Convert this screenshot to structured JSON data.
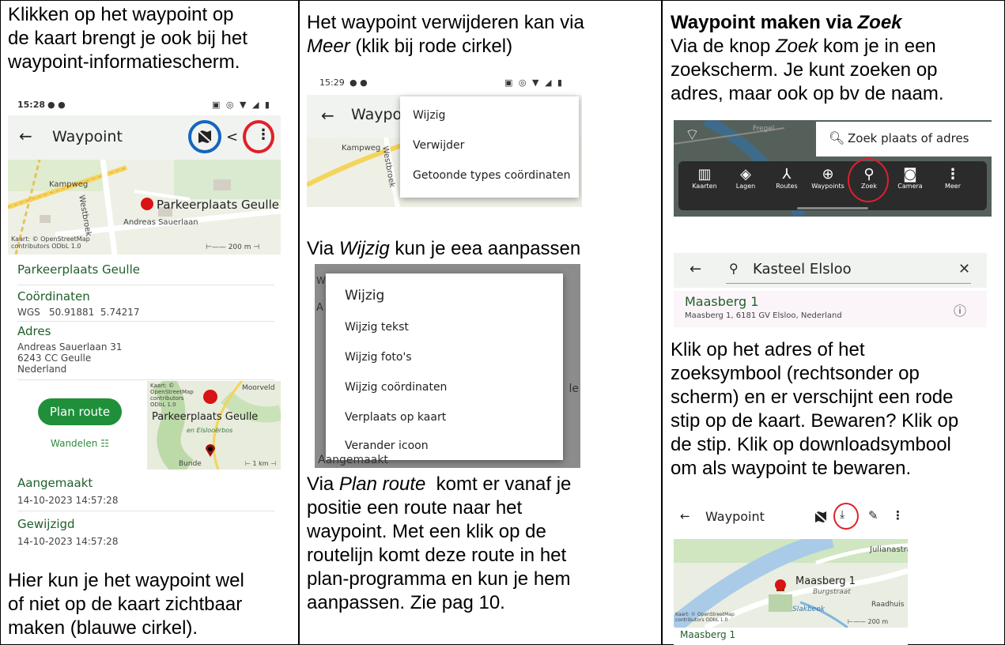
{
  "col1": {
    "intro": [
      "Klikken op het waypoint op",
      "de kaart brengt je ook bij het",
      "waypoint-informatiescherm."
    ],
    "outro": [
      "Hier kun je het waypoint wel",
      "of niet op de kaart zichtbaar",
      "maken (blauwe cirkel)."
    ],
    "screen": {
      "status_time": "15:28",
      "title": "Waypoint",
      "map_label_1": "Kampweg",
      "map_label_2": "Westbroek",
      "map_label_3": "Andreas Sauerlaan",
      "marker_label": "Parkeerplaats Geulle",
      "attribution": "Kaart: © OpenStreetMap contributors ODbL 1.0",
      "scale": "200 m",
      "name": "Parkeerplaats Geulle",
      "coords_heading": "Coördinaten",
      "coords_system": "WGS",
      "coords_value": "50.91881  5.74217",
      "address_heading": "Adres",
      "address_lines": [
        "Andreas Sauerlaan 31",
        "6243 CC Geulle",
        "Nederland"
      ],
      "plan_route": "Plan route",
      "walk_mode": "Wandelen",
      "mini_marker_label": "Parkeerplaats Geulle",
      "mini_map_1": "Moorveld",
      "mini_map_2": "en Elslooërbos",
      "mini_map_3": "Bunde",
      "mini_scale": "1 km",
      "created_heading": "Aangemaakt",
      "created_value": "14-10-2023 14:57:28",
      "changed_heading": "Gewijzigd",
      "changed_value": "14-10-2023 14:57:28"
    }
  },
  "col2": {
    "line1": "Het waypoint verwijderen kan via",
    "line2_em": "Meer",
    "line2_rest": " (klik bij rode cirkel)",
    "screen1": {
      "status_time": "15:29",
      "title": "Waypo",
      "menu": [
        "Wijzig",
        "Verwijder",
        "Getoonde types coördinaten"
      ],
      "map_label_1": "Kampweg",
      "map_label_2": "Westbroek"
    },
    "mid_pre": "Via ",
    "mid_em": "Wijzig",
    "mid_rest": " kun je eea aanpassen",
    "screen2": {
      "dialog_title": "Wijzig",
      "options": [
        "Wijzig tekst",
        "Wijzig foto's",
        "Wijzig coördinaten",
        "Verplaats op kaart",
        "Verander icoon"
      ],
      "bottom_label": "Aangemaakt"
    },
    "bottom_pre": "Via ",
    "bottom_em": "Plan route",
    "bottom_rest": "  komt er vanaf je",
    "bottom_lines": [
      "positie een route naar het",
      "waypoint. Met een klik op de",
      "routelijn komt deze route in het",
      "plan-programma en kun je hem",
      "aanpassen. Zie pag 10."
    ]
  },
  "col3": {
    "heading": "Waypoint maken via ",
    "heading_em": "Zoek",
    "p1_pre": "Via de knop ",
    "p1_em": "Zoek",
    "p1_rest": " kom je in een",
    "p1_lines": [
      "zoekscherm. Je kunt zoeken op",
      "adres, maar ook op bv de naam."
    ],
    "screen1": {
      "search_placeholder": "Zoek plaats of adres",
      "toolbar": [
        "Kaarten",
        "Lagen",
        "Routes",
        "Waypoints",
        "Zoek",
        "Camera",
        "Meer"
      ],
      "map_label": "Fregel"
    },
    "screen2": {
      "query": "Kasteel Elsloo",
      "result_title": "Maasberg 1",
      "result_sub": "Maasberg 1, 6181 GV Elsloo, Nederland"
    },
    "p2_lines": [
      "Klik op het adres of het",
      "zoeksymbool (rechtsonder op",
      "scherm) en er verschijnt een rode",
      "stip op de kaart. Bewaren? Klik op",
      "de stip. Klik op downloadsymbool",
      "om als waypoint te bewaren."
    ],
    "screen3": {
      "title": "Waypoint",
      "marker_label": "Maasberg 1",
      "map_label_1": "Julianastra",
      "map_label_2": "Burgstraat",
      "map_label_3": "Slakbeek",
      "map_label_4": "Raadhuis",
      "attribution": "Kaart: © OpenStreetMap contributors ODbL 1.0",
      "scale": "200 m",
      "name": "Maasberg 1"
    }
  },
  "colors": {
    "accent_green": "#1f8f3a",
    "red_circle": "#e0202a",
    "blue_circle": "#1565c0",
    "marker_red": "#d81414"
  }
}
